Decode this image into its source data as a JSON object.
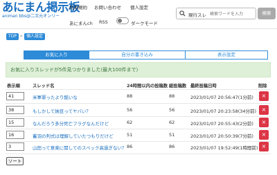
{
  "logo": {
    "title": "あにまん掲示板",
    "subtitle": "animan bbs@二次元オンリー"
  },
  "nav": {
    "terms": "利用規約",
    "contact": "お問い合わせ",
    "personal": "個人設定",
    "animanch": "あにまんch",
    "rss": "RSS",
    "dark_mode": "ダークモード"
  },
  "search": {
    "scope": "現行スレ",
    "placeholder": "検索ワードを入力",
    "button": "検索"
  },
  "breadcrumb": {
    "top": "TOP",
    "current": "個人設定"
  },
  "tabs": [
    {
      "label": "お気に入り",
      "active": true
    },
    {
      "label": "自分の書き込み",
      "active": false
    },
    {
      "label": "表示設定",
      "active": false
    }
  ],
  "alert": "お気に入りスレッドが5件見つかりました(最大100件まで)",
  "table": {
    "headers": {
      "no": "表示順",
      "name": "スレッド名",
      "posts24h": "24時間以内の投稿数",
      "total": "総投稿数",
      "last": "最終投稿日時",
      "delete": "削除"
    },
    "rows": [
      {
        "order": "41",
        "title": "米軍罪ったより酷いな",
        "posts": "88",
        "total": "88",
        "date": "2023/01/07 20:56:47(1分前)"
      },
      {
        "order": "38",
        "title": "もしかして納豆ってヤバい？",
        "posts": "56",
        "total": "56",
        "date": "2023/01/07 20:23:58(34分前)"
      },
      {
        "order": "15",
        "title": "なんだろう多分死亡フラグなんだけど",
        "posts": "62",
        "total": "62",
        "date": "2023/01/07 20:55:43(2分前)"
      },
      {
        "order": "16",
        "title": "蓄羽の判式は理解していたつもりだけど",
        "posts": "51",
        "total": "51",
        "date": "2023/01/07 20:50:39(7分前)"
      },
      {
        "order": "3",
        "title": "山田って意楽に関してのスペック高過ぎない？",
        "posts": "86",
        "total": "86",
        "date": "2023/01/07 19:52:49(1時間前)"
      }
    ]
  },
  "sort_button": "ソート",
  "colors": {
    "brand": "#1a6fc0",
    "accent": "#2d8bd7",
    "delete": "#dc3545",
    "alert_bg": "#dff0d8",
    "alert_text": "#3c763d"
  }
}
